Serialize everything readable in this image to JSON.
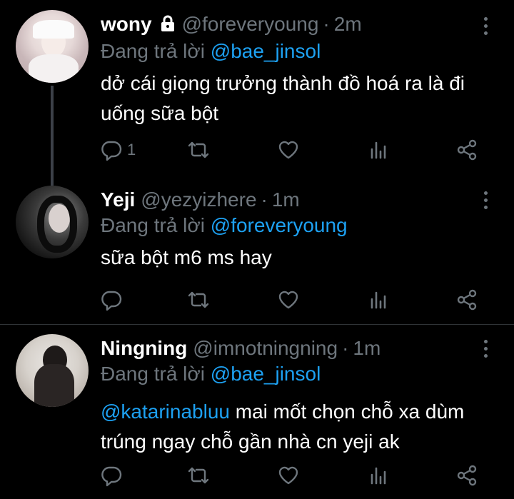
{
  "tweets": [
    {
      "name": "wony",
      "handle": "@foreveryoung",
      "time": "2m",
      "protected": true,
      "reply_prefix": "Đang trả lời",
      "reply_to": "@bae_jinsol",
      "text_mention": "",
      "text": "dở cái giọng trưởng thành đồ hoá ra là đi uống sữa bột",
      "reply_count": "1"
    },
    {
      "name": "Yeji",
      "handle": "@yezyizhere",
      "time": "1m",
      "protected": false,
      "reply_prefix": "Đang trả lời",
      "reply_to": "@foreveryoung",
      "text_mention": "",
      "text": "sữa bột m6 ms hay",
      "reply_count": ""
    },
    {
      "name": "Ningning",
      "handle": "@imnotningning",
      "time": "1m",
      "protected": false,
      "reply_prefix": "Đang trả lời",
      "reply_to": "@bae_jinsol",
      "text_mention": "@katarinabluu",
      "text": " mai mốt chọn chỗ xa dùm trúng ngay chỗ gần nhà cn yeji ak",
      "reply_count": ""
    }
  ],
  "separator": "·",
  "colors": {
    "background": "#000000",
    "muted": "#6e767d",
    "link": "#1da1f2",
    "text": "#ffffff",
    "divider": "#2f3336"
  },
  "icons": [
    "reply-icon",
    "retweet-icon",
    "like-icon",
    "analytics-icon",
    "share-icon",
    "more-icon",
    "lock-icon"
  ]
}
